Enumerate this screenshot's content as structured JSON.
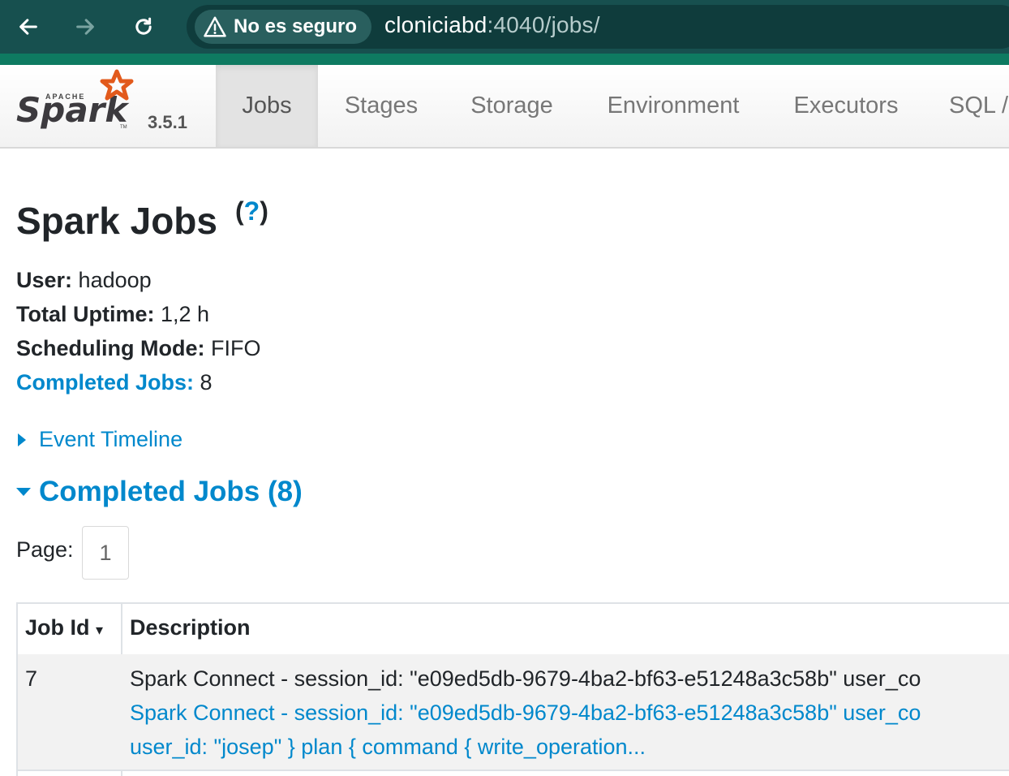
{
  "browser": {
    "security_label": "No es seguro",
    "url_host": "cloniciabd",
    "url_rest": ":4040/jobs/"
  },
  "sparkNav": {
    "version": "3.5.1",
    "tabs": [
      "Jobs",
      "Stages",
      "Storage",
      "Environment",
      "Executors",
      "SQL /"
    ]
  },
  "page": {
    "title": "Spark Jobs",
    "help": "?",
    "user_label": "User:",
    "user_value": "hadoop",
    "uptime_label": "Total Uptime:",
    "uptime_value": "1,2 h",
    "scheduling_label": "Scheduling Mode:",
    "scheduling_value": "FIFO",
    "completed_label": "Completed Jobs:",
    "completed_value": "8",
    "event_timeline": "Event Timeline",
    "completed_header": "Completed Jobs (8)",
    "page_label": "Page:",
    "page_value": "1"
  },
  "table": {
    "col_jobid": "Job Id",
    "col_sort": "▾",
    "col_description": "Description",
    "rows": [
      {
        "job_id": "7",
        "desc_line1": "Spark Connect - session_id: \"e09ed5db-9679-4ba2-bf63-e51248a3c58b\" user_co",
        "desc_line2": "Spark Connect - session_id: \"e09ed5db-9679-4ba2-bf63-e51248a3c58b\" user_co",
        "desc_line3": "user_id: \"josep\" } plan { command { write_operation..."
      }
    ]
  }
}
